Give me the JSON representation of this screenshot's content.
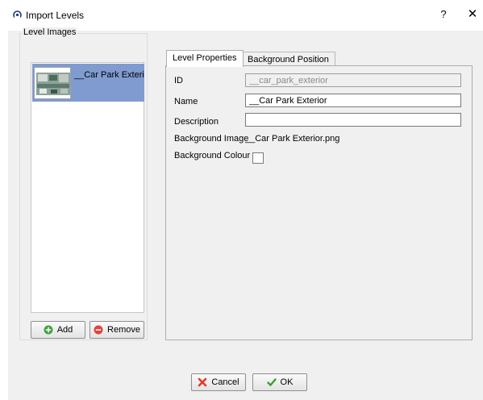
{
  "window": {
    "title": "Import Levels",
    "help_label": "?",
    "close_label": "✕"
  },
  "level_images": {
    "group_title": "Level Images",
    "items": [
      {
        "label": "__Car Park Exterior"
      }
    ],
    "add_label": "Add",
    "remove_label": "Remove"
  },
  "tabs": [
    {
      "label": "Level Properties",
      "active": true
    },
    {
      "label": "Background Position",
      "active": false
    }
  ],
  "properties": {
    "id_label": "ID",
    "id_value": "__car_park_exterior",
    "name_label": "Name",
    "name_value": "__Car Park Exterior",
    "description_label": "Description",
    "description_value": "",
    "bg_image_label": "Background Image",
    "bg_image_value": "__Car Park Exterior.png",
    "bg_colour_label": "Background Colour",
    "bg_colour": "#ffffff"
  },
  "footer": {
    "cancel_label": "Cancel",
    "ok_label": "OK"
  },
  "colors": {
    "selection": "#7f9bd0",
    "add_icon": "#3fa33f",
    "remove_icon": "#e0443a",
    "ok_icon": "#36a032",
    "cancel_icon": "#e03b2f"
  }
}
